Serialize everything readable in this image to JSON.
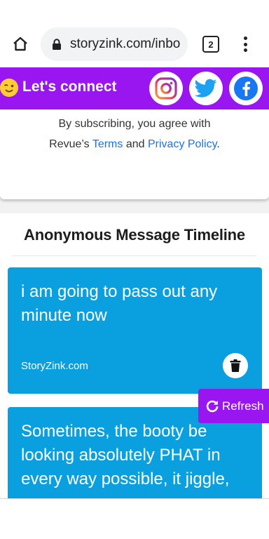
{
  "browser": {
    "url": "storyzink.com/inbo",
    "tab_count": "2"
  },
  "connect_bar": {
    "label": "Let's connect",
    "background": "#9a16f0",
    "socials": [
      "instagram-icon",
      "twitter-icon",
      "facebook-icon"
    ]
  },
  "subscribe": {
    "line1": "By subscribing, you agree with",
    "prefix": "Revue’s ",
    "terms_link": "Terms",
    "and_text": " and ",
    "privacy_link": "Privacy Policy",
    "suffix": "."
  },
  "timeline": {
    "title": "Anonymous Message Timeline",
    "card_color": "#0aa0df",
    "messages": [
      {
        "text": "i am going to pass out any minute now",
        "brand": "StoryZink.com"
      },
      {
        "text": "Sometimes, the booty be looking absolutely PHAT in every way possible, it jiggle,"
      }
    ]
  },
  "refresh_button": {
    "label": "Refresh"
  }
}
